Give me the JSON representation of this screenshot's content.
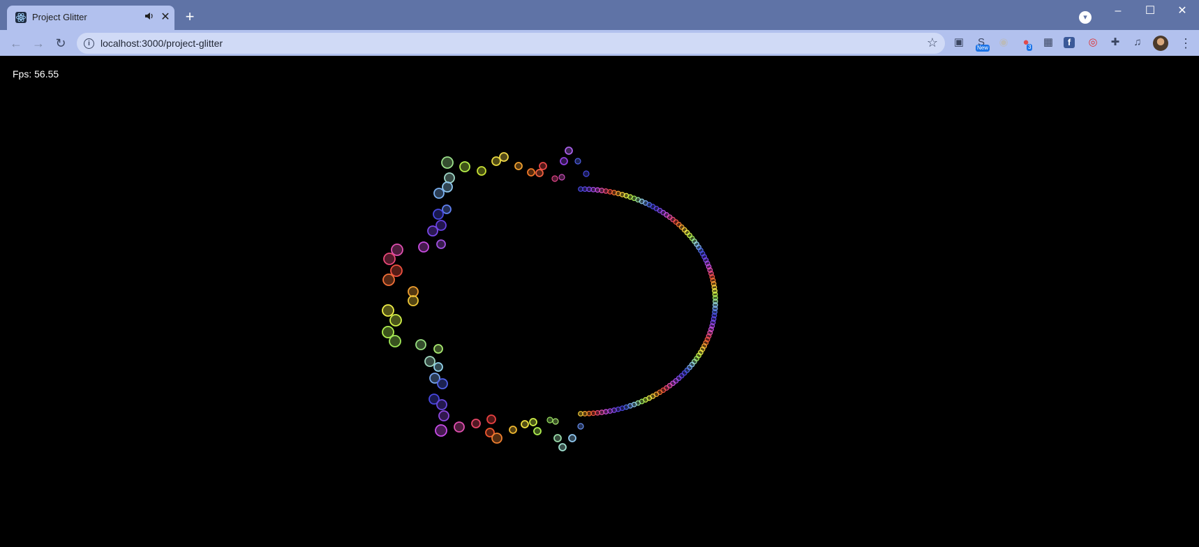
{
  "browser": {
    "tab": {
      "title": "Project Glitter",
      "favicon": "react-icon",
      "audio_icon": "speaker-icon",
      "close_label": "✕"
    },
    "new_tab_label": "+",
    "omnibox": {
      "url": "localhost:3000/project-glitter"
    },
    "extensions": [
      {
        "name": "screenshot-icon",
        "badge": ""
      },
      {
        "name": "extension-new-icon",
        "badge": "New"
      },
      {
        "name": "circle-extension-icon",
        "badge": ""
      },
      {
        "name": "record-extension-icon",
        "badge": "3"
      },
      {
        "name": "gift-extension-icon",
        "badge": ""
      },
      {
        "name": "facebook-icon",
        "badge": ""
      },
      {
        "name": "target-extension-icon",
        "badge": ""
      },
      {
        "name": "puzzle-icon",
        "badge": ""
      },
      {
        "name": "media-control-icon",
        "badge": ""
      }
    ]
  },
  "page": {
    "fps_label": "Fps:",
    "fps_value": "56.55"
  },
  "colors": {
    "background": "#000000",
    "tab_active": "#b2c1ee",
    "tabstrip": "#5f73a6"
  }
}
